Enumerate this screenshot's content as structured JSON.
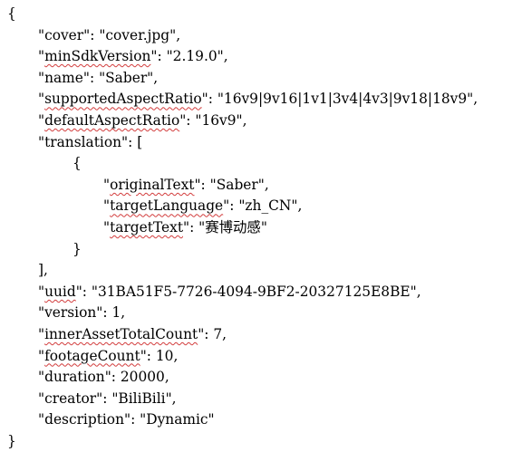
{
  "json_lines": [
    {
      "indent": 0,
      "text": "{"
    },
    {
      "indent": 1,
      "key": "cover",
      "value": "\"cover.jpg\"",
      "trail": ","
    },
    {
      "indent": 1,
      "key": "minSdkVersion",
      "value": "\"2.19.0\"",
      "trail": ",",
      "squiggle": true
    },
    {
      "indent": 1,
      "key": "name",
      "value": "\"Saber\"",
      "trail": ","
    },
    {
      "indent": 1,
      "key": "supportedAspectRatio",
      "value": "\"16v9|9v16|1v1|3v4|4v3|9v18|18v9\"",
      "trail": ",",
      "squiggle": true
    },
    {
      "indent": 1,
      "key": "defaultAspectRatio",
      "value": "\"16v9\"",
      "trail": ",",
      "squiggle": true
    },
    {
      "indent": 1,
      "key": "translation",
      "value": "[",
      "trail": ""
    },
    {
      "indent": 2,
      "text": "{"
    },
    {
      "indent": 3,
      "key": "originalText",
      "value": "\"Saber\"",
      "trail": ",",
      "squiggle": true
    },
    {
      "indent": 3,
      "key": "targetLanguage",
      "value": "\"zh_CN\"",
      "trail": ",",
      "squiggle": true
    },
    {
      "indent": 3,
      "key": "targetText",
      "value": "\"赛博动感\"",
      "trail": "",
      "squiggle": true
    },
    {
      "indent": 2,
      "text": "}"
    },
    {
      "indent": 1,
      "text": "],"
    },
    {
      "indent": 1,
      "key": "uuid",
      "value": "\"31BA51F5-7726-4094-9BF2-20327125E8BE\"",
      "trail": ",",
      "squiggle": true
    },
    {
      "indent": 1,
      "key": "version",
      "value": "1",
      "trail": ","
    },
    {
      "indent": 1,
      "key": "innerAssetTotalCount",
      "value": "7",
      "trail": ",",
      "squiggle": true
    },
    {
      "indent": 1,
      "key": "footageCount",
      "value": "10",
      "trail": ",",
      "squiggle": true
    },
    {
      "indent": 1,
      "key": "duration",
      "value": "20000",
      "trail": ","
    },
    {
      "indent": 1,
      "key": "creator",
      "value": "\"BiliBili\"",
      "trail": ","
    },
    {
      "indent": 1,
      "key": "description",
      "value": "\"Dynamic\"",
      "trail": ""
    },
    {
      "indent": 0,
      "text": "}"
    }
  ]
}
